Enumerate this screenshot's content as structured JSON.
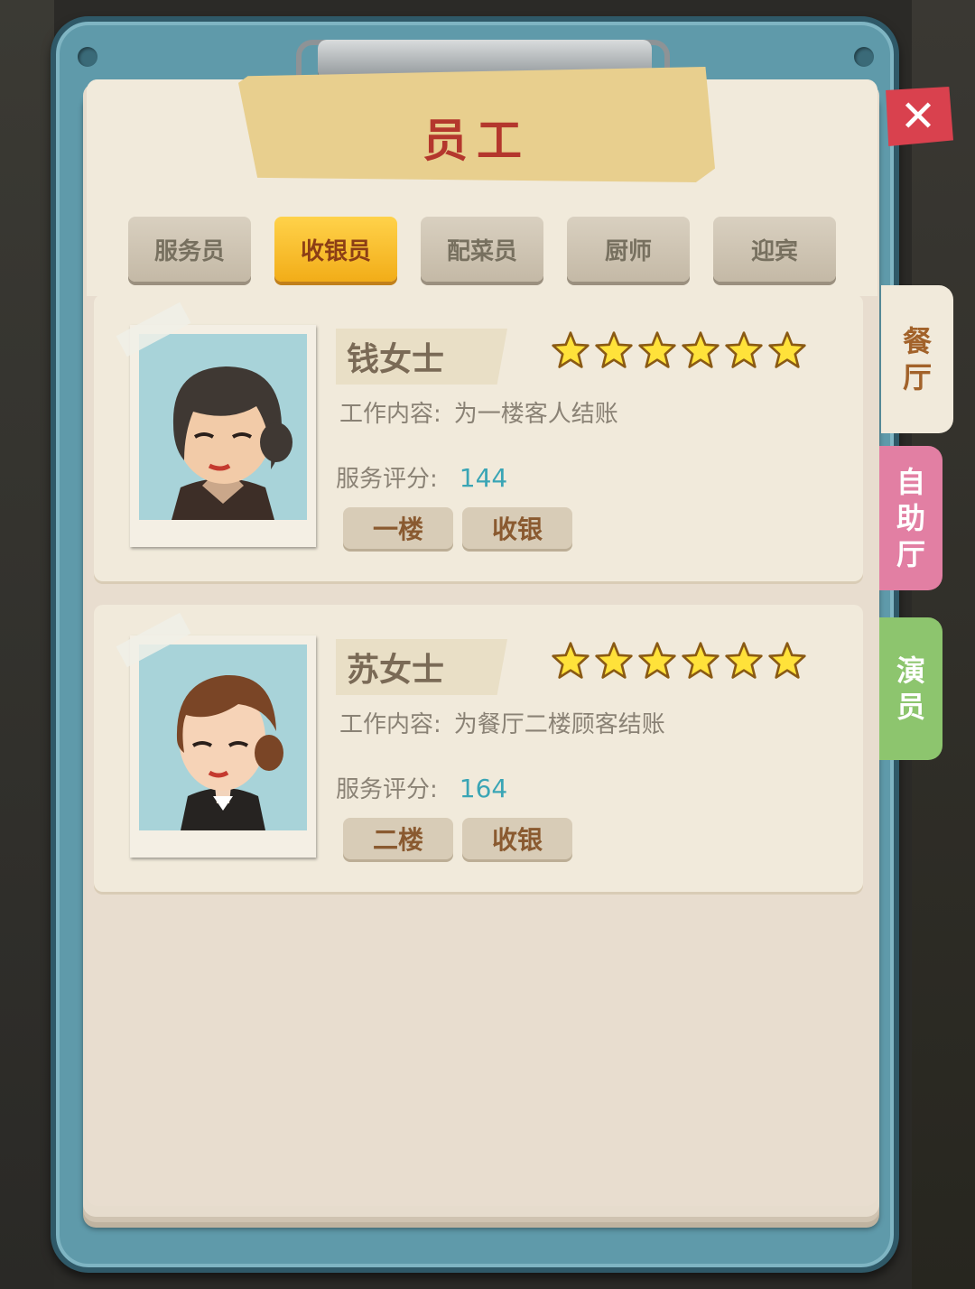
{
  "header": {
    "title": "员工",
    "close_label": "✕"
  },
  "tabs": [
    {
      "label": "服务员",
      "active": false
    },
    {
      "label": "收银员",
      "active": true
    },
    {
      "label": "配菜员",
      "active": false
    },
    {
      "label": "厨师",
      "active": false
    },
    {
      "label": "迎宾",
      "active": false
    }
  ],
  "side_tabs": [
    {
      "chars": [
        "餐",
        "厅"
      ],
      "color": "#f1eadb",
      "text_color": "#a2622a"
    },
    {
      "chars": [
        "自",
        "助",
        "厅"
      ],
      "color": "#e27fa3",
      "text_color": "#ffffff"
    },
    {
      "chars": [
        "演",
        "员"
      ],
      "color": "#8dc56e",
      "text_color": "#ffffff"
    }
  ],
  "staff": [
    {
      "name": "钱女士",
      "stars": 6,
      "job_label": "工作内容:",
      "job_text": "为一楼客人结账",
      "score_label": "服务评分:",
      "score": "144",
      "floor_tag": "一楼",
      "role_tag": "收银",
      "hair_color": "#3f3833"
    },
    {
      "name": "苏女士",
      "stars": 6,
      "job_label": "工作内容:",
      "job_text": "为餐厅二楼顾客结账",
      "score_label": "服务评分:",
      "score": "164",
      "floor_tag": "二楼",
      "role_tag": "收银",
      "hair_color": "#7a4526"
    }
  ],
  "colors": {
    "board": "#5f9aaa",
    "active_tab": "#f2ad18",
    "score": "#3aa5b5",
    "title": "#b4372d"
  }
}
